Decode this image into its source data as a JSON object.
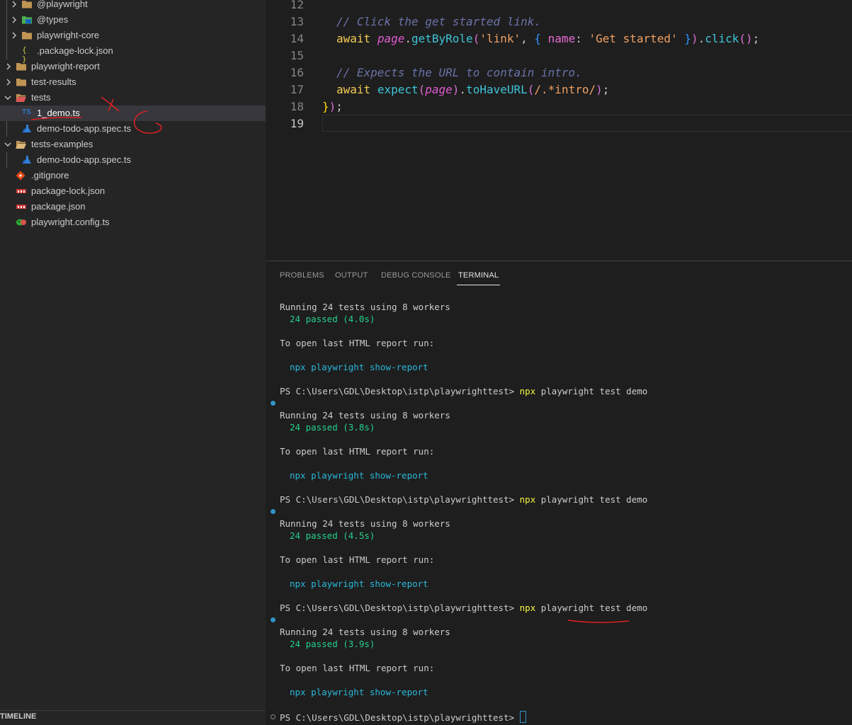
{
  "sidebar": {
    "items": [
      {
        "label": "@playwright",
        "kind": "folder",
        "expanded": false
      },
      {
        "label": "@types",
        "kind": "folder-ts",
        "expanded": false
      },
      {
        "label": "playwright-core",
        "kind": "folder",
        "expanded": false
      },
      {
        "label": ".package-lock.json",
        "kind": "json"
      },
      {
        "label": "playwright-report",
        "kind": "folder",
        "expanded": false
      },
      {
        "label": "test-results",
        "kind": "folder",
        "expanded": false
      },
      {
        "label": "tests",
        "kind": "folder-test",
        "expanded": true
      },
      {
        "label": "1_demo.ts",
        "kind": "ts",
        "icon_text": "TS",
        "selected": true
      },
      {
        "label": "demo-todo-app.spec.ts",
        "kind": "spec"
      },
      {
        "label": "tests-examples",
        "kind": "folder",
        "expanded": true
      },
      {
        "label": "demo-todo-app.spec.ts",
        "kind": "spec"
      },
      {
        "label": ".gitignore",
        "kind": "git"
      },
      {
        "label": "package-lock.json",
        "kind": "npm"
      },
      {
        "label": "package.json",
        "kind": "npm"
      },
      {
        "label": "playwright.config.ts",
        "kind": "playwright"
      }
    ],
    "timeline_label": "TIMELINE"
  },
  "editor": {
    "line_numbers": [
      "12",
      "13",
      "14",
      "15",
      "16",
      "17",
      "18",
      "19"
    ],
    "line13": "// Click the get started link.",
    "line14": {
      "await": "await",
      "page": "page",
      "dot": ".",
      "fn": "getByRole",
      "p1": "(",
      "str1": "'link'",
      "comma": ", ",
      "b2": "{",
      "prop": " name",
      "colon": ": ",
      "str2": "'Get started'",
      "b2c": " }",
      "p2": ")",
      "dot2": ".",
      "fn2": "click",
      "p3": "()",
      "semi": ";"
    },
    "line16": "// Expects the URL to contain intro.",
    "line17": {
      "await": "await",
      "fn": "expect",
      "p1": "(",
      "page": "page",
      "p2": ")",
      "dot": ".",
      "fn2": "toHaveURL",
      "p3": "(",
      "regex": "/.*intro/",
      "p4": ")",
      "semi": ";"
    },
    "line18": {
      "b1": "}",
      "p": ")",
      "semi": ";"
    }
  },
  "panel": {
    "tabs": [
      "PROBLEMS",
      "OUTPUT",
      "DEBUG CONSOLE",
      "TERMINAL"
    ],
    "active_tab": "TERMINAL",
    "terminal": {
      "running": "Running 24 tests using 8 workers",
      "passed_runs": [
        "24 passed (4.0s)",
        "24 passed (3.8s)",
        "24 passed (4.5s)",
        "24 passed (3.9s)"
      ],
      "open_report": "To open last HTML report run:",
      "report_cmd": {
        "npx": "npx",
        "rest": " playwright show-report"
      },
      "prompt": "PS C:\\Users\\GDL\\Desktop\\istp\\playwrighttest> ",
      "cmd": {
        "npx": "npx",
        "rest": " playwright test demo"
      }
    }
  },
  "colors": {
    "accent_blue": "#2f95c7",
    "annotation_red": "#e02020",
    "passed_green": "#23d18b",
    "cmd_yellow": "#f5f543"
  }
}
